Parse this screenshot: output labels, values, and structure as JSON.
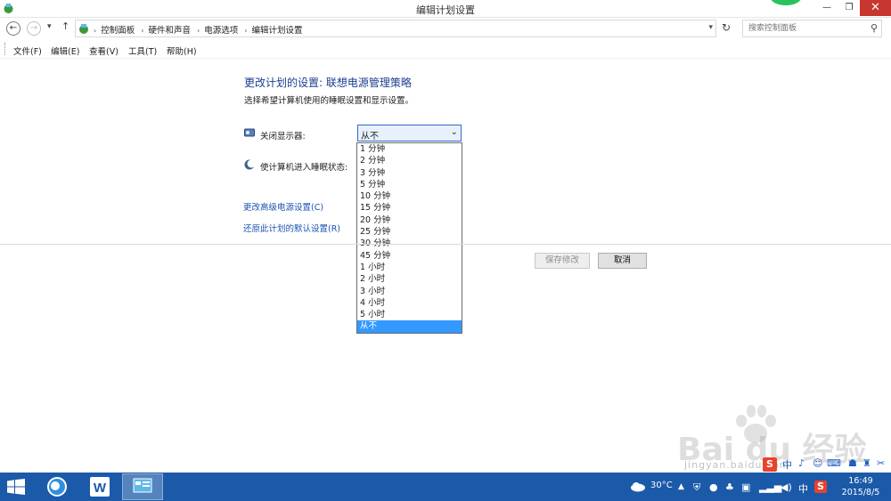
{
  "window": {
    "title": "编辑计划设置",
    "minimize_glyph": "—",
    "maximize_glyph": "❐",
    "close_glyph": "✕"
  },
  "nav": {
    "back_glyph": "←",
    "forward_glyph": "→",
    "recent_glyph": "▾",
    "up_glyph": "↑",
    "refresh_glyph": "↻"
  },
  "breadcrumb": {
    "items": [
      "控制面板",
      "硬件和声音",
      "电源选项",
      "编辑计划设置"
    ],
    "separator": "›"
  },
  "search": {
    "placeholder": "搜索控制面板"
  },
  "menu": {
    "file": "文件(F)",
    "edit": "编辑(E)",
    "view": "查看(V)",
    "tools": "工具(T)",
    "help": "帮助(H)"
  },
  "content": {
    "heading": "更改计划的设置: 联想电源管理策略",
    "subtext": "选择希望计算机使用的睡眠设置和显示设置。",
    "display_label": "关闭显示器:",
    "sleep_label": "使计算机进入睡眠状态:",
    "display_selected": "从不",
    "display_options": [
      "1 分钟",
      "2 分钟",
      "3 分钟",
      "5 分钟",
      "10 分钟",
      "15 分钟",
      "20 分钟",
      "25 分钟",
      "30 分钟",
      "45 分钟",
      "1 小时",
      "2 小时",
      "3 小时",
      "4 小时",
      "5 小时",
      "从不"
    ],
    "advanced_link": "更改高级电源设置(C)",
    "restore_link": "还原此计划的默认设置(R)",
    "save_button": "保存修改",
    "cancel_button": "取消"
  },
  "watermark": {
    "brand": "Bai du 经验",
    "url": "jingyan.baidu.com"
  },
  "langbar": {
    "ime_char": "中"
  },
  "taskbar": {
    "weather": "30°C",
    "ime": "中",
    "time": "16:49",
    "date": "2015/8/5"
  },
  "colors": {
    "taskbar": "#1b5aa8",
    "heading": "#1a3d8f",
    "link": "#1a52b0",
    "selection": "#3399ff",
    "close": "#c7372f"
  }
}
